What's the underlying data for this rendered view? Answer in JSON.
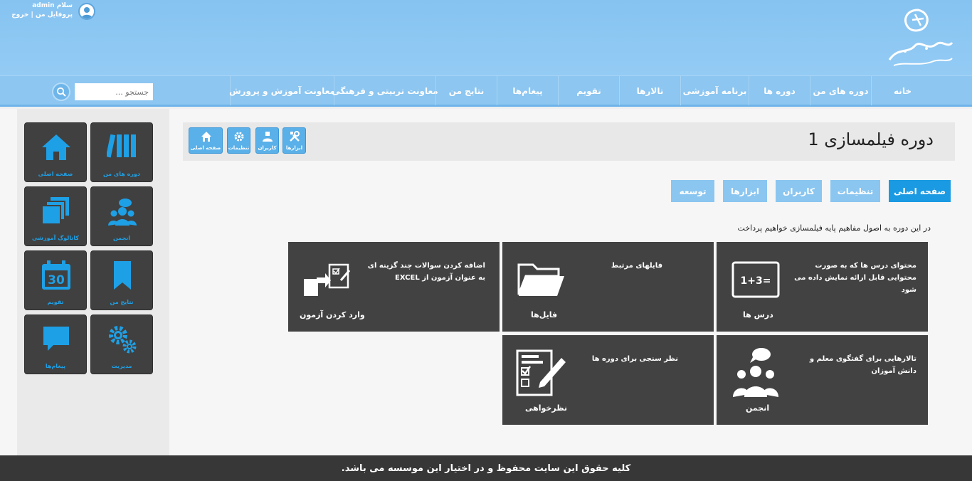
{
  "user": {
    "greeting": "سلام admin",
    "profile_link": "پروفایل من",
    "separator": "|",
    "logout_link": "خروج"
  },
  "nav": {
    "items": [
      {
        "label": "خانه"
      },
      {
        "label": "دوره های من"
      },
      {
        "label": "دوره ها"
      },
      {
        "label": "برنامه آموزشی"
      },
      {
        "label": "تالارها"
      },
      {
        "label": "تقویم"
      },
      {
        "label": "پیغام‌ها"
      },
      {
        "label": "نتایج من"
      },
      {
        "label": "معاونت تربیتی و فرهنگی"
      },
      {
        "label": "معاونت آموزش و پرورش"
      }
    ],
    "search_placeholder": "جستجو ..."
  },
  "sidebar": {
    "tiles": [
      {
        "label": "دوره های من",
        "icon": "books-icon"
      },
      {
        "label": "صفحه اصلی",
        "icon": "home-icon"
      },
      {
        "label": "انجمن",
        "icon": "forum-icon"
      },
      {
        "label": "کاتالوگ آموزشی",
        "icon": "catalog-icon"
      },
      {
        "label": "نتایج من",
        "icon": "bookmark-icon"
      },
      {
        "label": "تقویم",
        "icon": "calendar-icon",
        "day": "30"
      },
      {
        "label": "مدیریت",
        "icon": "gears-icon"
      },
      {
        "label": "پیغام‌ها",
        "icon": "chat-icon"
      }
    ]
  },
  "course": {
    "title": "دوره فیلمسازی 1",
    "mini_buttons": [
      {
        "label": "ابزارها",
        "icon": "tools-icon"
      },
      {
        "label": "کاربران",
        "icon": "user-icon"
      },
      {
        "label": "تنظیمات",
        "icon": "gear-icon"
      },
      {
        "label": "صفحه اصلی",
        "icon": "home-icon"
      }
    ],
    "tabs": [
      {
        "label": "صفحه اصلی",
        "active": true
      },
      {
        "label": "تنظیمات",
        "active": false
      },
      {
        "label": "کاربران",
        "active": false
      },
      {
        "label": "ابزارها",
        "active": false
      },
      {
        "label": "توسعه",
        "active": false
      }
    ],
    "description": "در این دوره به اصول مفاهیم پایه فیلمسازی خواهیم پرداخت",
    "cards": [
      {
        "label": "درس ها",
        "text": "محتوای درس ها که به صورت محتوایی قابل ارائه نمایش داده می شود",
        "icon": "lesson-board-icon",
        "board_text": "1+3="
      },
      {
        "label": "فایل‌ها",
        "text": "فایلهای مرتبط",
        "icon": "folder-icon"
      },
      {
        "label": "وارد کردن آزمون",
        "text": "اضافه کردن سوالات چند گزینه ای به عنوان آزمون از EXCEL",
        "icon": "import-exam-icon"
      },
      {
        "label": "انجمن",
        "text": "تالارهایی برای گفتگوی معلم و دانش آموزان",
        "icon": "forum-people-icon"
      },
      {
        "label": "نظرخواهی",
        "text": "نظر سنجی برای دوره ها",
        "icon": "survey-icon"
      }
    ]
  },
  "footer": {
    "text": "کلیه حقوق این سایت محفوظ و در اختیار این موسسه می باشد."
  },
  "colors": {
    "header": "#8ec8f3",
    "accent": "#1a9ae2",
    "tile": "#404040",
    "tile_icon": "#1ea0e6",
    "footer": "#373737"
  }
}
